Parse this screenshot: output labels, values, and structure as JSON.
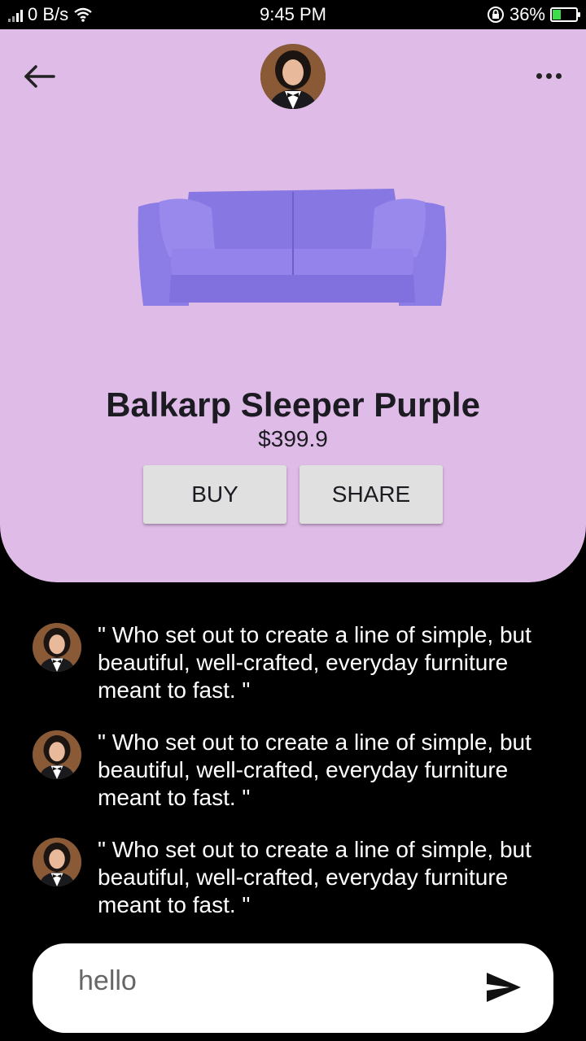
{
  "status_bar": {
    "net_speed": "0 B/s",
    "time": "9:45 PM",
    "battery_percent": "36%",
    "battery_level": 0.36,
    "battery_color": "#3ddc4a"
  },
  "product": {
    "name": "Balkarp Sleeper Purple",
    "price": "$399.9",
    "buy_label": "BUY",
    "share_label": "SHARE",
    "card_color": "#dfbbe8",
    "sofa_color": "#8a77e6"
  },
  "comments": [
    {
      "text": "\" Who set out to create a line of simple, but beautiful, well-crafted, everyday furniture meant to fast. \""
    },
    {
      "text": "\" Who set out to create a line of simple, but beautiful, well-crafted, everyday furniture meant to fast. \""
    },
    {
      "text": "\" Who set out to create a line of simple, but beautiful, well-crafted, everyday furniture meant to fast. \""
    }
  ],
  "composer": {
    "value": "hello"
  },
  "icons": {
    "back": "arrow-left-icon",
    "more": "more-horizontal-icon",
    "send": "send-icon",
    "wifi": "wifi-icon",
    "signal": "signal-icon",
    "lock": "rotation-lock-icon",
    "battery": "battery-charging-icon"
  }
}
